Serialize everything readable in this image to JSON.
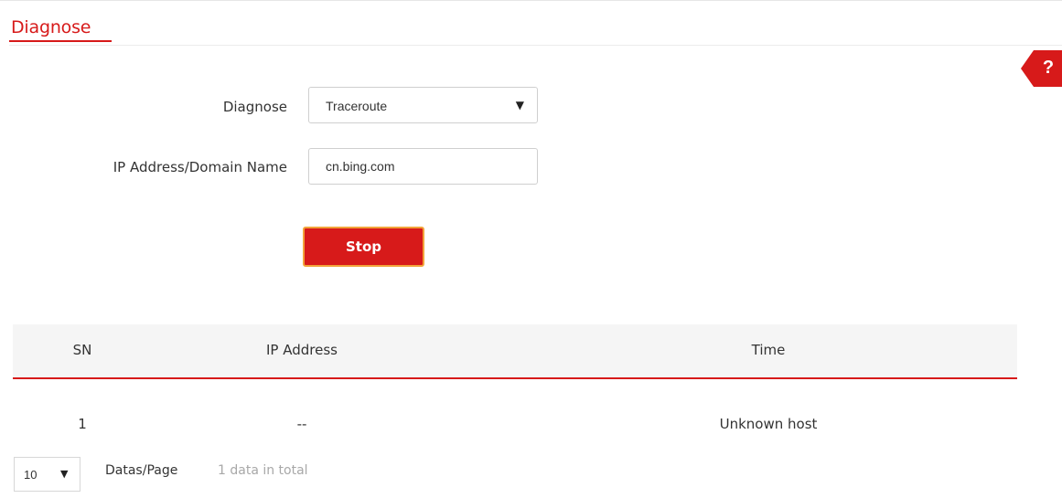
{
  "page": {
    "title": "Diagnose",
    "help_label": "?"
  },
  "form": {
    "diagnose_label": "Diagnose",
    "diagnose_value": "Traceroute",
    "ip_label": "IP Address/Domain Name",
    "ip_value": "cn.bing.com",
    "stop_button_label": "Stop"
  },
  "table": {
    "columns": [
      "SN",
      "IP Address",
      "Time"
    ],
    "rows": [
      [
        "1",
        "--",
        "Unknown host"
      ]
    ]
  },
  "pager": {
    "per_page_value": "10",
    "per_page_label": "Datas/Page",
    "total_text": "1 data in total"
  },
  "colors": {
    "accent": "#d71a1a",
    "button_border": "#f2a33a",
    "header_bg": "#f5f5f5"
  }
}
